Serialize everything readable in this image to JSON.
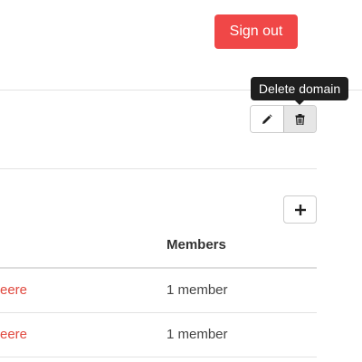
{
  "header": {
    "sign_out_label": "Sign out"
  },
  "domain_actions": {
    "tooltip": "Delete domain",
    "edit_icon": "pencil-icon",
    "delete_icon": "trash-icon"
  },
  "groups": {
    "add_icon": "plus-icon",
    "columns": {
      "members": "Members"
    },
    "rows": [
      {
        "name_fragment": "eere",
        "members": "1 member"
      },
      {
        "name_fragment": "eere",
        "members": "1 member"
      }
    ]
  },
  "colors": {
    "accent": "#f04747",
    "link": "#e0483e",
    "tooltip_bg": "#1f1f1f",
    "divider": "#e3e3e3"
  }
}
